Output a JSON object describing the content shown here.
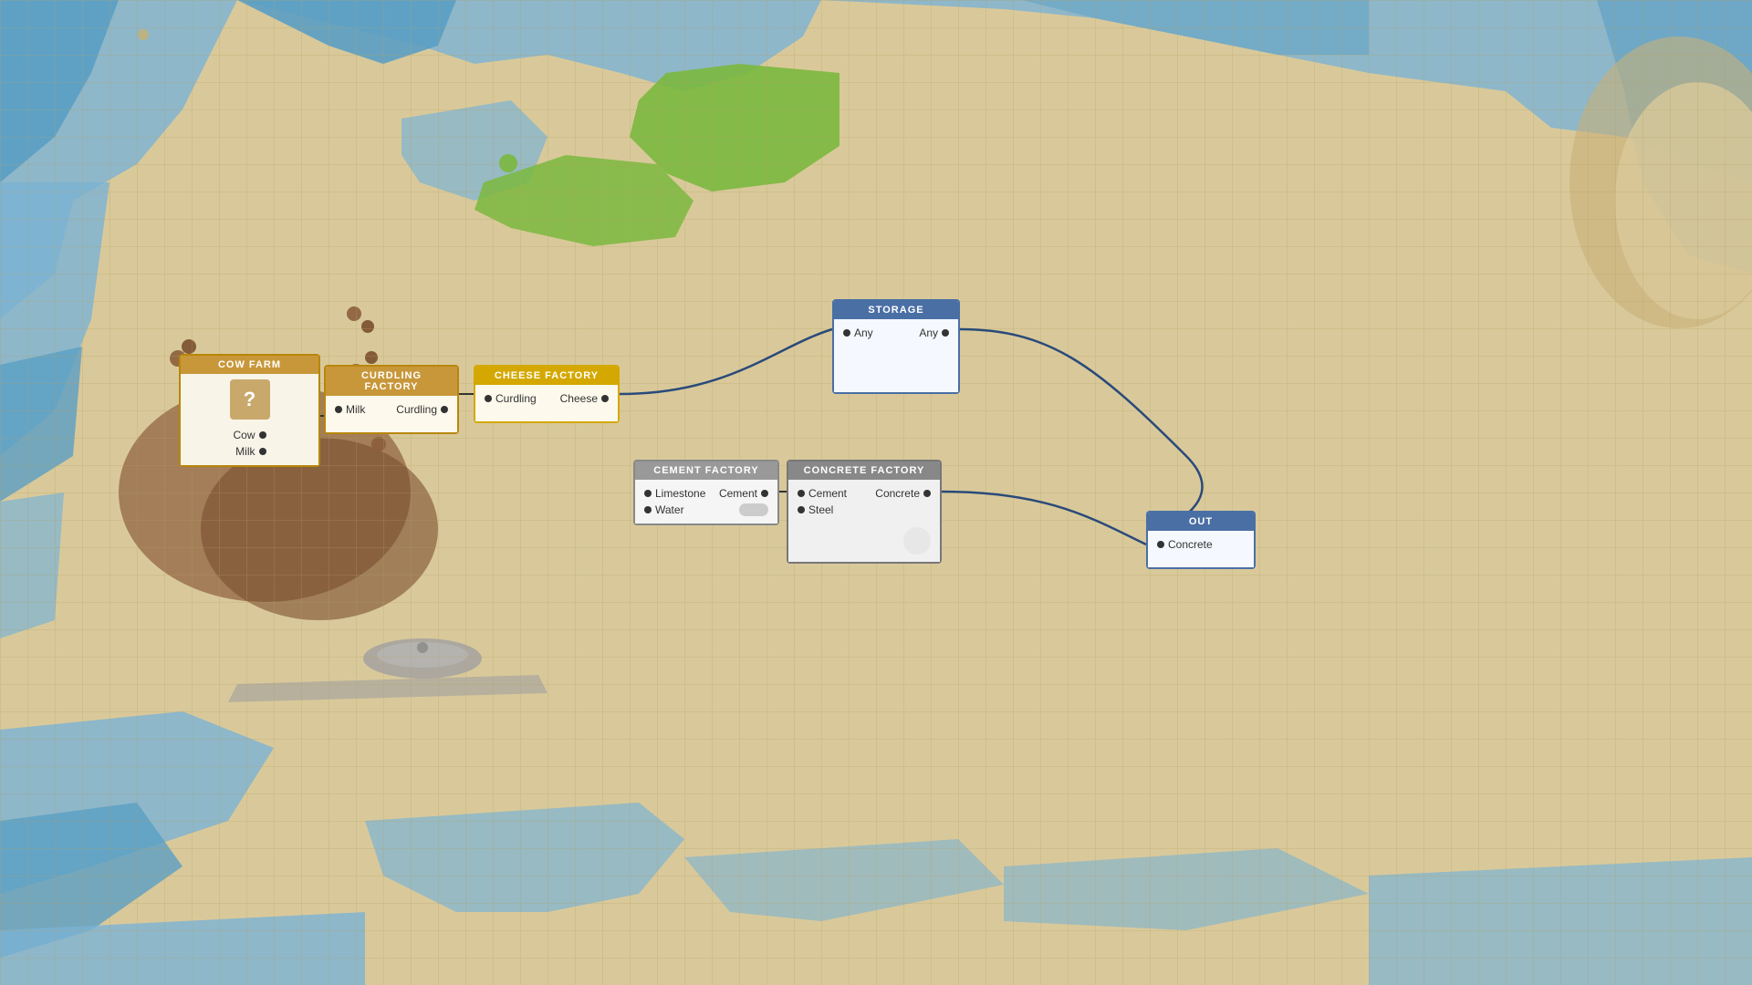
{
  "map": {
    "background_color": "#d9c99a",
    "grid_color": "rgba(180,160,100,0.25)"
  },
  "nodes": {
    "cow_farm": {
      "title": "COW FARM",
      "outputs": [
        "Cow",
        "Milk"
      ],
      "icon": "?"
    },
    "curdling_factory": {
      "title": "CURDLING FACTORY",
      "input": "Milk",
      "output": "Curdling"
    },
    "cheese_factory": {
      "title": "CHEESE FACTORY",
      "input": "Curdling",
      "output": "Cheese"
    },
    "storage": {
      "title": "STORAGE",
      "input": "Any",
      "output": "Any"
    },
    "cement_factory": {
      "title": "CEMENT FACTORY",
      "inputs": [
        "Limestone",
        "Water"
      ],
      "output": "Cement"
    },
    "concrete_factory": {
      "title": "CONCRETE FACTORY",
      "inputs": [
        "Cement",
        "Steel"
      ],
      "output": "Concrete"
    },
    "out_node": {
      "title": "OUT",
      "output": "Concrete"
    }
  }
}
